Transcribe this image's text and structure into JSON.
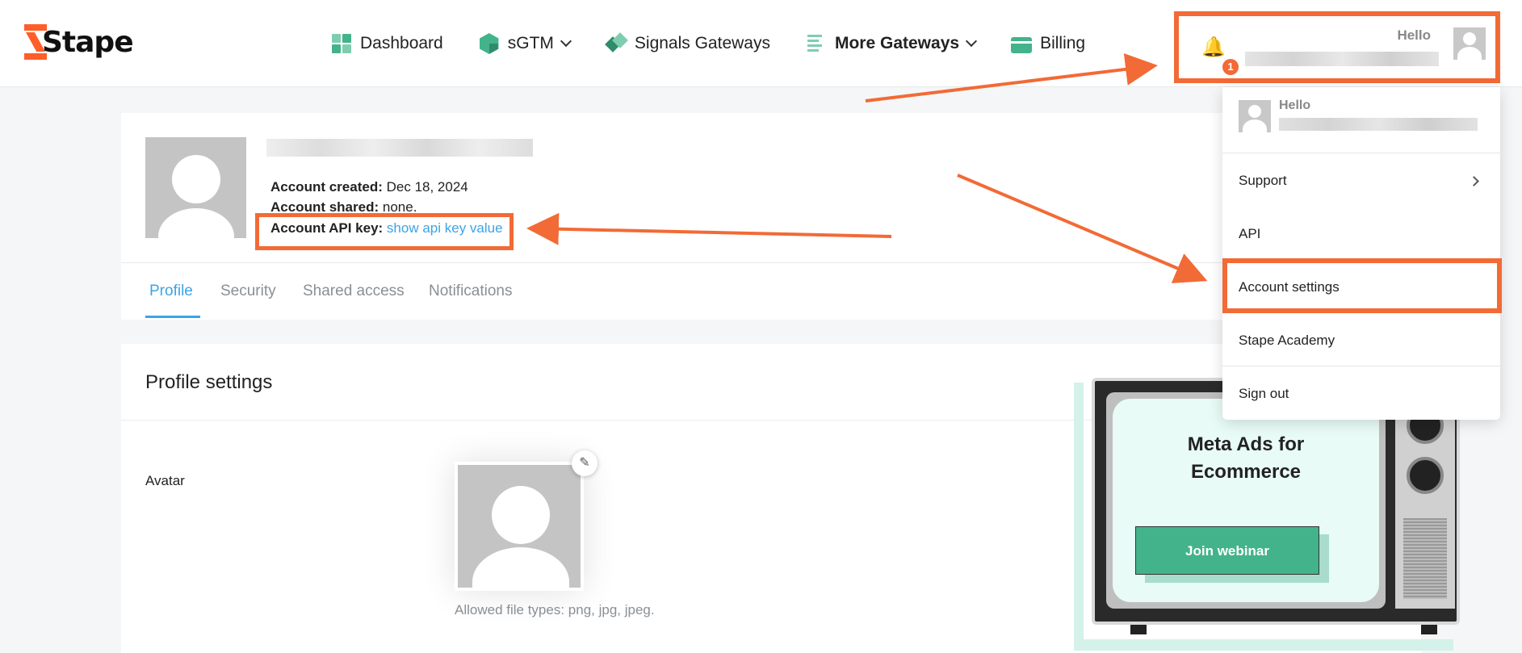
{
  "logo": {
    "text": "Stape"
  },
  "nav": [
    {
      "label": "Dashboard",
      "icon": "dashboard-icon"
    },
    {
      "label": "sGTM",
      "icon": "cube-icon"
    },
    {
      "label": "Signals Gateways",
      "icon": "signals-icon"
    },
    {
      "label": "More Gateways",
      "icon": "gateways-icon"
    },
    {
      "label": "Billing",
      "icon": "billing-icon"
    }
  ],
  "user": {
    "hello": "Hello",
    "notifications": "1"
  },
  "account": {
    "created_label": "Account created:",
    "created_value": "Dec 18, 2024",
    "shared_label": "Account shared:",
    "shared_value": "none.",
    "api_label": "Account API key:",
    "api_link": "show api key value"
  },
  "tabs": [
    "Profile",
    "Security",
    "Shared access",
    "Notifications"
  ],
  "settings": {
    "title": "Profile settings",
    "avatar_label": "Avatar",
    "file_types": "Allowed file types: png, jpg, jpeg."
  },
  "promo": {
    "title_line1": "Meta Ads for",
    "title_line2": "Ecommerce",
    "button": "Join webinar"
  },
  "dropdown": {
    "hello": "Hello",
    "items": [
      "Support",
      "API",
      "Account settings",
      "Stape Academy",
      "Sign out"
    ]
  },
  "colors": {
    "accent": "#3ba4e6",
    "brand": "#43b38b",
    "annotation": "#f26a36"
  }
}
